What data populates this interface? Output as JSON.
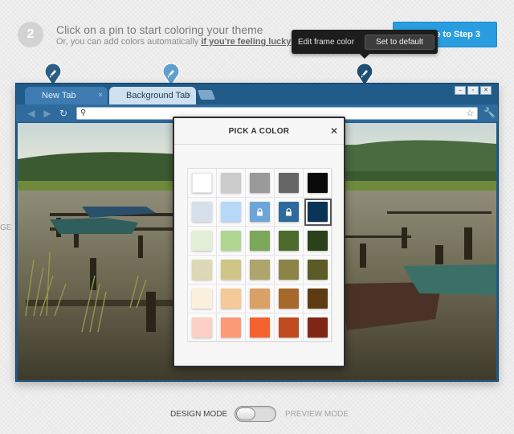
{
  "header": {
    "step_number": "2",
    "title": "Click on a pin to start coloring your theme",
    "subtitle_prefix": "Or, you can add colors automatically ",
    "subtitle_link": "if you're feeling lucky",
    "continue_button": "ue to Step 3"
  },
  "tooltip": {
    "label": "Edit frame color",
    "button": "Set to default"
  },
  "pins": [
    {
      "name": "tab-pin",
      "color": "#2b5f86"
    },
    {
      "name": "background-tab-pin",
      "color": "#5f9fd0"
    },
    {
      "name": "frame-pin",
      "color": "#1f4f73"
    }
  ],
  "browser": {
    "tabs": [
      {
        "label": "New Tab",
        "close": "×"
      },
      {
        "label": "Background Tab",
        "close": "×"
      }
    ],
    "window_controls": [
      "–",
      "▫",
      "✕"
    ],
    "frame_color": "#1f5a88"
  },
  "picker": {
    "title": "PICK A COLOR",
    "close": "✕",
    "swatches": [
      [
        "#ffffff",
        "#cbcbcb",
        "#9a9a9a",
        "#666666",
        "#0a0a0a"
      ],
      [
        "#d5e0ea",
        "#b7d8f6",
        "#6ea5d8",
        "#2f6a9e",
        "#0a3557"
      ],
      [
        "#e2efd6",
        "#b1d68f",
        "#7ca85a",
        "#4d6b2d",
        "#2b4119"
      ],
      [
        "#ddd8b6",
        "#cfc586",
        "#ada56b",
        "#8b8446",
        "#5c5a26"
      ],
      [
        "#fbf0dc",
        "#f3ca98",
        "#d9a166",
        "#a7692a",
        "#5f3b13"
      ],
      [
        "#fcd0c4",
        "#fa9a77",
        "#f6622f",
        "#c04a20",
        "#7f2717"
      ]
    ],
    "locked": [
      [
        1,
        2
      ],
      [
        1,
        3
      ]
    ],
    "selected": [
      1,
      4
    ]
  },
  "mode": {
    "design": "DESIGN MODE",
    "preview": "PREVIEW MODE"
  },
  "edge_text": "GE"
}
